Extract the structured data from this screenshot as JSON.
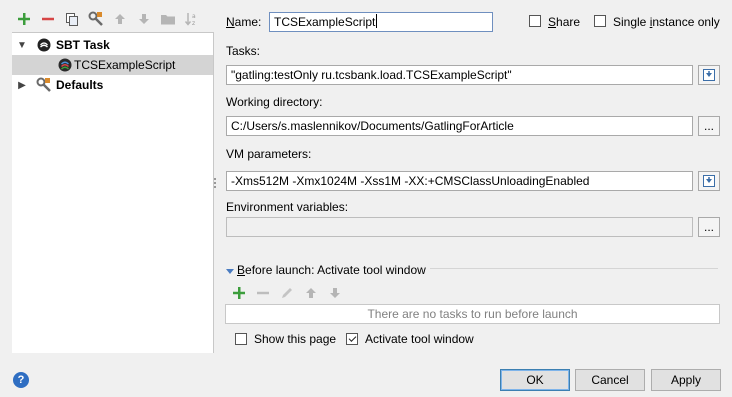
{
  "toolbar": {
    "icons": [
      "plus-icon",
      "minus-icon",
      "copy-icon",
      "wrench-icon",
      "arrow-up-icon",
      "arrow-down-icon",
      "folder-icon",
      "sort-az-icon"
    ],
    "colors": {
      "add": "#3c9d3c",
      "remove": "#d64545"
    }
  },
  "tree": {
    "items": [
      {
        "label": "SBT Task",
        "bold": true,
        "expanded": true
      },
      {
        "label": "TCSExampleScript",
        "bold": false,
        "selected": true
      },
      {
        "label": "Defaults",
        "bold": true,
        "expanded": false
      }
    ]
  },
  "form": {
    "name_label": "Name:",
    "name_value": "TCSExampleScript",
    "share_label": "Share",
    "single_instance_label": "Single instance only",
    "tasks_label": "Tasks:",
    "tasks_value": "\"gatling:testOnly ru.tcsbank.load.TCSExampleScript\"",
    "workdir_label": "Working directory:",
    "workdir_value": "C:/Users/s.maslennikov/Documents/GatlingForArticle",
    "browse_label": "...",
    "vm_label": "VM parameters:",
    "vm_value": "-Xms512M -Xmx1024M -Xss1M -XX:+CMSClassUnloadingEnabled",
    "env_label": "Environment variables:",
    "env_value": "",
    "env_browse_label": "..."
  },
  "before_launch": {
    "title": "Before launch: Activate tool window",
    "empty_text": "There are no tasks to run before launch",
    "show_page_label": "Show this page",
    "show_page_checked": false,
    "activate_label": "Activate tool window",
    "activate_checked": true
  },
  "buttons": {
    "ok": "OK",
    "cancel": "Cancel",
    "apply": "Apply"
  },
  "help_label": "?"
}
